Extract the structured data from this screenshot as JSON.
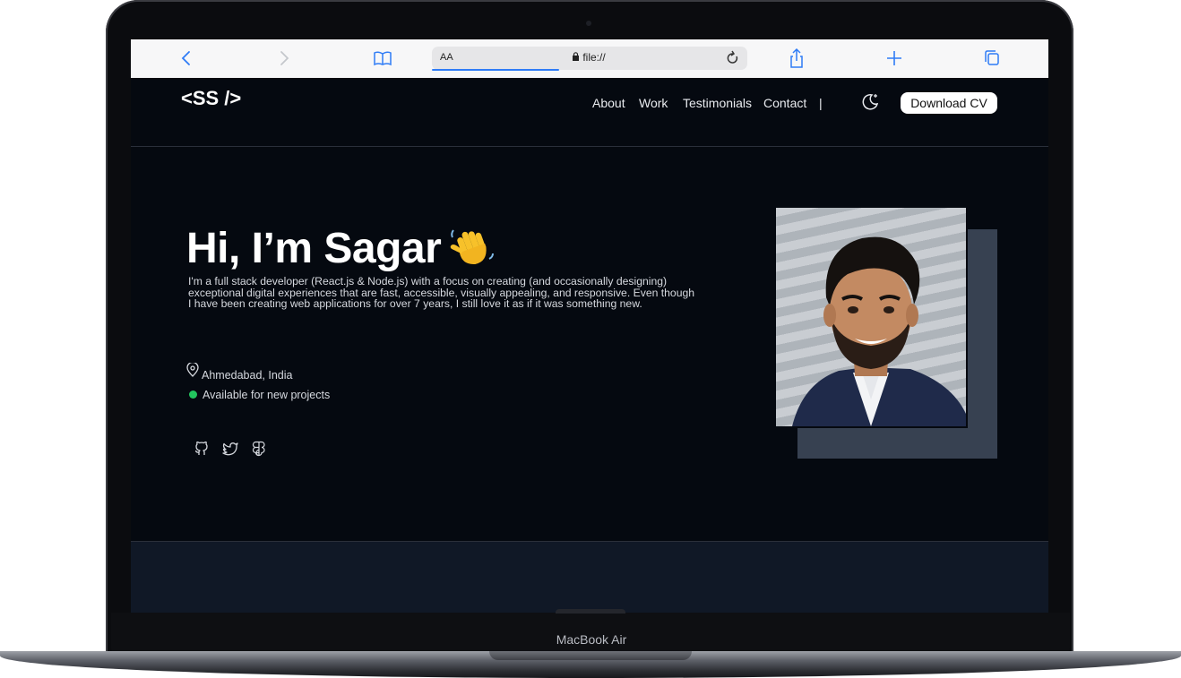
{
  "device": {
    "label": "MacBook Air"
  },
  "browser": {
    "addr_aa": "AA",
    "url": "file://",
    "icons": {
      "back": "chevron-left-icon",
      "forward": "chevron-right-icon",
      "bookmarks": "book-icon",
      "reload": "reload-icon",
      "share": "share-icon",
      "new_tab": "plus-icon",
      "tabs": "tabs-icon"
    }
  },
  "site": {
    "logo": "<SS />",
    "nav": [
      "About",
      "Work",
      "Testimonials",
      "Contact"
    ],
    "separator": "|",
    "download_cv": "Download CV"
  },
  "hero": {
    "title": "Hi, I’m Sagar",
    "description": "I'm a full stack developer (React.js & Node.js) with a focus on creating (and occasionally designing) exceptional digital experiences that are fast, accessible, visually appealing, and responsive. Even though I have been creating web applications for over 7 years, I still love it as if it was something new.",
    "location": "Ahmedabad, India",
    "availability": "Available for new projects",
    "socials": [
      "github-icon",
      "twitter-icon",
      "figma-icon"
    ]
  },
  "colors": {
    "background": "#050910",
    "accent_status": "#22c55e",
    "photo_shadow": "#374151",
    "browser_blue": "#2f7cf6"
  }
}
